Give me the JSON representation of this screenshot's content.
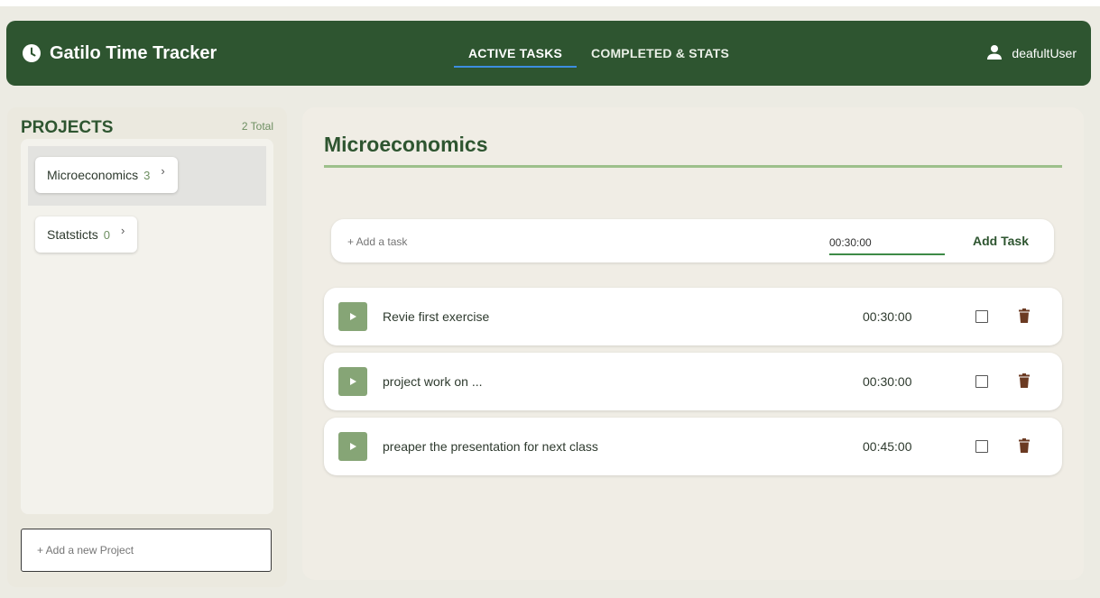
{
  "app": {
    "title": "Gatilo Time Tracker",
    "icon": "clock-icon"
  },
  "nav": {
    "tabs": [
      {
        "label": "ACTIVE TASKS",
        "active": true
      },
      {
        "label": "COMPLETED & STATS",
        "active": false
      }
    ]
  },
  "user": {
    "name": "deafultUser",
    "icon": "person-icon"
  },
  "sidebar": {
    "heading": "PROJECTS",
    "total": "2 Total",
    "projects": [
      {
        "name": "Microeconomics",
        "count": "3",
        "selected": true
      },
      {
        "name": "Statsticts",
        "count": "0",
        "selected": false
      }
    ],
    "add_placeholder": "+ Add a new Project"
  },
  "main": {
    "project_title": "Microeconomics",
    "add_task": {
      "placeholder": "+ Add a task",
      "time_value": "00:30:00",
      "button_label": "Add Task"
    },
    "tasks": [
      {
        "name": "Revie first exercise",
        "time": "00:30:00",
        "done": false
      },
      {
        "name": "project work on ...",
        "time": "00:30:00",
        "done": false
      },
      {
        "name": "preaper the presentation for next class",
        "time": "00:45:00",
        "done": false
      }
    ]
  },
  "colors": {
    "header_bg": "#2e5530",
    "accent_green": "#86a576",
    "tab_underline": "#3d8de0",
    "trash": "#6b3a22"
  }
}
